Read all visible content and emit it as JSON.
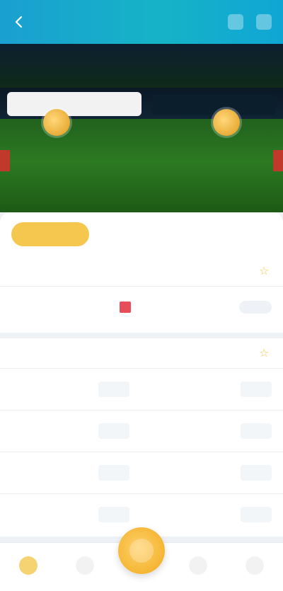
{
  "header": {
    "title": ""
  },
  "hero": {
    "search_placeholder": "",
    "team_left": "",
    "team_right": "",
    "vs": "",
    "info": ""
  },
  "tabs": [
    {
      "label": ""
    },
    {
      "label": ""
    },
    {
      "label": ""
    },
    {
      "label": ""
    }
  ],
  "section1": {
    "title": "",
    "row": {
      "left": "",
      "middle": "",
      "right": ""
    }
  },
  "section2": {
    "title": "",
    "rows": [
      {
        "a": "",
        "b": "",
        "c": "",
        "d": ""
      },
      {
        "a": "",
        "b": "",
        "c": "",
        "d": ""
      },
      {
        "a": "",
        "b": "",
        "c": "",
        "d": ""
      },
      {
        "a": "",
        "b": "",
        "c": "",
        "d": ""
      }
    ]
  },
  "bottom_nav": [
    {
      "label": ""
    },
    {
      "label": ""
    },
    {
      "label": ""
    },
    {
      "label": ""
    }
  ],
  "colors": {
    "accent": "#f6c74e",
    "header": "#1aa6cf"
  }
}
